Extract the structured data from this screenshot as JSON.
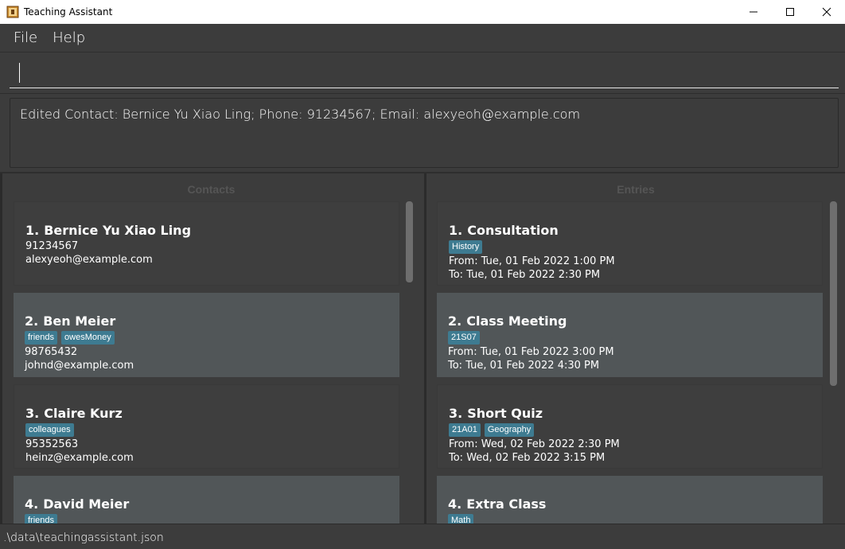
{
  "window": {
    "title": "Teaching Assistant",
    "icons": {
      "app": "app-icon",
      "minimize": "minimize-icon",
      "maximize": "maximize-icon",
      "close": "close-icon"
    }
  },
  "menu": {
    "file": "File",
    "help": "Help"
  },
  "command": {
    "value": "",
    "placeholder": ""
  },
  "result": {
    "text": "Edited Contact: Bernice Yu Xiao Ling; Phone: 91234567; Email: alexyeoh@example.com"
  },
  "contacts": {
    "title": "Contacts",
    "items": [
      {
        "index": "1.",
        "name": "Bernice Yu Xiao Ling",
        "tags": [],
        "phone": "91234567",
        "email": "alexyeoh@example.com"
      },
      {
        "index": "2.",
        "name": "Ben Meier",
        "tags": [
          "friends",
          "owesMoney"
        ],
        "phone": "98765432",
        "email": "johnd@example.com"
      },
      {
        "index": "3.",
        "name": "Claire Kurz",
        "tags": [
          "colleagues"
        ],
        "phone": "95352563",
        "email": "heinz@example.com"
      },
      {
        "index": "4.",
        "name": "David Meier",
        "tags": [
          "friends"
        ],
        "phone": "",
        "email": ""
      }
    ]
  },
  "entries": {
    "title": "Entries",
    "items": [
      {
        "index": "1.",
        "name": "Consultation",
        "tags": [
          "History"
        ],
        "from": "From: Tue, 01 Feb 2022 1:00 PM",
        "to": "To: Tue, 01 Feb 2022 2:30 PM"
      },
      {
        "index": "2.",
        "name": "Class Meeting",
        "tags": [
          "21S07"
        ],
        "from": "From: Tue, 01 Feb 2022 3:00 PM",
        "to": "To: Tue, 01 Feb 2022 4:30 PM"
      },
      {
        "index": "3.",
        "name": "Short Quiz",
        "tags": [
          "21A01",
          "Geography"
        ],
        "from": "From: Wed, 02 Feb 2022 2:30 PM",
        "to": "To: Wed, 02 Feb 2022 3:15 PM"
      },
      {
        "index": "4.",
        "name": "Extra Class",
        "tags": [
          "Math"
        ],
        "from": "",
        "to": ""
      }
    ]
  },
  "status": {
    "path": ".\\data\\teachingassistant.json"
  },
  "colors": {
    "background": "#3c3c3c",
    "tag": "#3e7b91",
    "card_alt": "#515658"
  }
}
